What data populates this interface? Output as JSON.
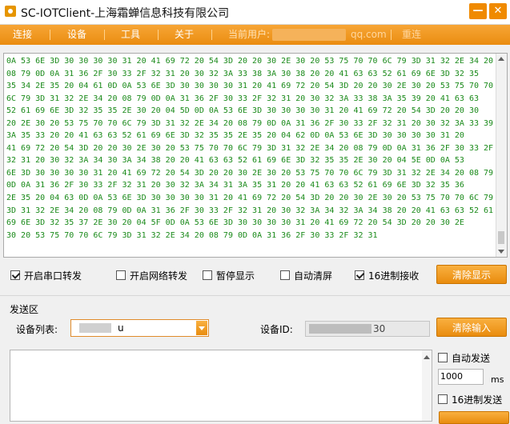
{
  "window": {
    "title": "SC-IOTClient-上海霜蝉信息科技有限公司",
    "min_label": "—",
    "close_label": "✕"
  },
  "menu": {
    "connect": "连接",
    "device": "设备",
    "tools": "工具",
    "about": "关于",
    "current_user_label": "当前用户:",
    "current_user_suffix": "qq.com",
    "reconnect": "重连"
  },
  "receive": {
    "lines": [
      "0A 53 6E 3D 30 30 30 30 31 20 41 69 72 20 54 3D 20 20 30 2E 30 20 53 75 70 70 6C 79 3D 31 32 2E 34 20",
      "08 79 0D 0A 31 36 2F 30 33 2F 32 31 20 30 32 3A 33 38 3A 30 38 20 20 41 63 63 52 61 69 6E 3D 32 35",
      "35 34 2E 35 20 04 61 0D 0A 53 6E 3D 30 30 30 30 31 20 41 69 72 20 54 3D 20 20 30 2E 30 20 53 75 70 70",
      "6C 79 3D 31 32 2E 34 20 08 79 0D 0A 31 36 2F 30 33 2F 32 31 20 30 32 3A 33 38 3A 35 39 20 41 63 63",
      "52 61 69 6E 3D 32 35 35 2E 30 20 04 5D 0D 0A 53 6E 3D 30 30 30 30 31 20 41 69 72 20 54 3D 20 20 30",
      "20 2E 30 20 53 75 70 70 6C 79 3D 31 32 2E 34 20 08 79 0D 0A 31 36 2F 30 33 2F 32 31 20 30 32 3A 33 39",
      "3A 35 33 20 20 41 63 63 52 61 69 6E 3D 32 35 35 2E 35 20 04 62 0D 0A 53 6E 3D 30 30 30 30 31 20",
      "41 69 72 20 54 3D 20 20 30 2E 30 20 53 75 70 70 6C 79 3D 31 32 2E 34 20 08 79 0D 0A 31 36 2F 30 33 2F",
      "32 31 20 30 32 3A 34 30 3A 34 38 20 20 41 63 63 52 61 69 6E 3D 32 35 35 2E 30 20 04 5E 0D 0A 53",
      "6E 3D 30 30 30 30 31 20 41 69 72 20 54 3D 20 20 30 2E 30 20 53 75 70 70 6C 79 3D 31 32 2E 34 20 08 79",
      "0D 0A 31 36 2F 30 33 2F 32 31 20 30 32 3A 34 31 3A 35 31 20 20 41 63 63 52 61 69 6E 3D 32 35 36",
      "2E 35 20 04 63 0D 0A 53 6E 3D 30 30 30 30 31 20 41 69 72 20 54 3D 20 20 30 2E 30 20 53 75 70 70 6C 79",
      "3D 31 32 2E 34 20 08 79 0D 0A 31 36 2F 30 33 2F 32 31 20 30 32 3A 34 32 3A 34 38 20 20 41 63 63 52 61",
      "69 6E 3D 32 35 37 2E 30 20 04 5F 0D 0A 53 6E 3D 30 30 30 30 31 20 41 69 72 20 54 3D 20 20 30 2E",
      "30 20 53 75 70 70 6C 79 3D 31 32 2E 34 20 08 79 0D 0A 31 36 2F 30 33 2F 32 31"
    ]
  },
  "options": {
    "serial_forward": "开启串口转发",
    "serial_forward_checked": true,
    "net_forward": "开启网络转发",
    "net_forward_checked": false,
    "pause_display": "暂停显示",
    "pause_display_checked": false,
    "auto_clear": "自动清屏",
    "auto_clear_checked": false,
    "hex_receive": "16进制接收",
    "hex_receive_checked": true,
    "clear_display": "清除显示"
  },
  "send": {
    "section_label": "发送区",
    "device_list_label": "设备列表:",
    "device_list_value": "u",
    "device_id_label": "设备ID:",
    "device_id_value": "30",
    "clear_input": "清除输入",
    "auto_send": "自动发送",
    "auto_send_checked": false,
    "interval_value": "1000",
    "interval_unit": "ms",
    "hex_send": "16进制发送",
    "hex_send_checked": false
  },
  "colors": {
    "accent": "#f39a1e",
    "hex_text": "#1a8a1a"
  }
}
